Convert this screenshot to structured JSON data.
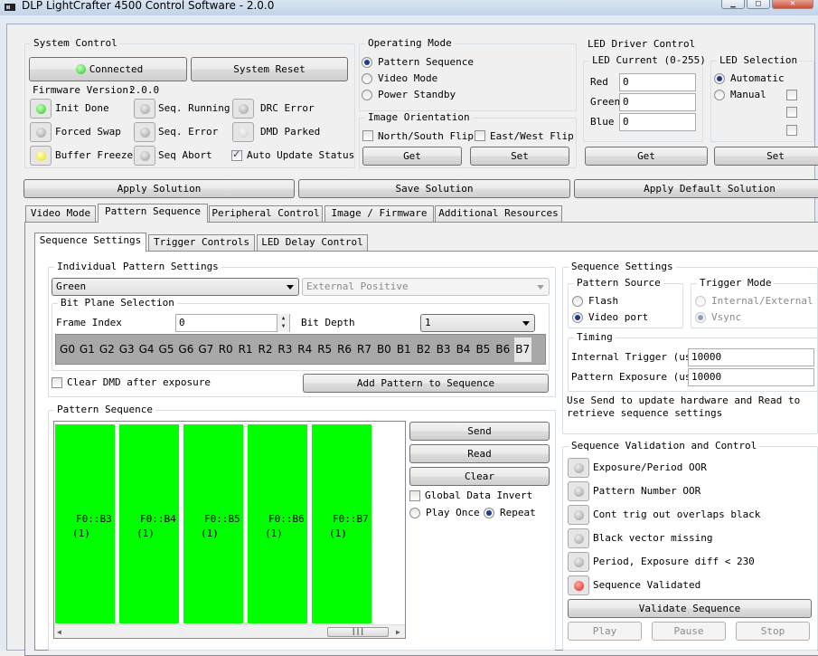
{
  "window": {
    "title": "DLP LightCrafter 4500 Control Software - 2.0.0"
  },
  "system_control": {
    "title": "System Control",
    "connect_label": "Connected",
    "reset_label": "System Reset",
    "firmware_label": "Firmware Version:",
    "firmware_value": "2.0.0",
    "status": [
      {
        "label": "Init Done",
        "state": "green"
      },
      {
        "label": "Seq. Running",
        "state": "gray"
      },
      {
        "label": "DRC Error",
        "state": "gray"
      },
      {
        "label": "Forced Swap",
        "state": "gray"
      },
      {
        "label": "Seq. Error",
        "state": "gray"
      },
      {
        "label": "DMD Parked",
        "state": "light"
      },
      {
        "label": "Buffer Freeze",
        "state": "yellow"
      },
      {
        "label": "Seq Abort",
        "state": "gray"
      }
    ],
    "auto_update_label": "Auto Update Status",
    "auto_update_checked": true
  },
  "operating_mode": {
    "title": "Operating Mode",
    "options": [
      "Pattern Sequence",
      "Video Mode",
      "Power Standby"
    ],
    "selected": "Pattern Sequence"
  },
  "image_orientation": {
    "title": "Image Orientation",
    "ns_flip": "North/South Flip",
    "ew_flip": "East/West Flip",
    "get_label": "Get",
    "set_label": "Set"
  },
  "led_driver": {
    "title": "LED Driver Control",
    "current_title": "LED Current (0-255)",
    "red_label": "Red",
    "red_value": "0",
    "green_label": "Green",
    "green_value": "0",
    "blue_label": "Blue",
    "blue_value": "0",
    "selection_title": "LED Selection",
    "automatic_label": "Automatic",
    "manual_label": "Manual",
    "selected": "Automatic",
    "get_label": "Get",
    "set_label": "Set"
  },
  "solutions": {
    "apply_label": "Apply Solution",
    "save_label": "Save Solution",
    "default_label": "Apply Default Solution"
  },
  "main_tabs": [
    "Video Mode",
    "Pattern Sequence",
    "Peripheral Control",
    "Image / Firmware",
    "Additional Resources"
  ],
  "main_tab_active": "Pattern Sequence",
  "sub_tabs": [
    "Sequence Settings",
    "Trigger Controls",
    "LED Delay Control"
  ],
  "sub_tab_active": "Sequence Settings",
  "individual_pattern": {
    "title": "Individual Pattern Settings",
    "color_value": "Green",
    "trigger_value": "External Positive",
    "bitplane_title": "Bit Plane Selection",
    "frame_index_label": "Frame Index",
    "frame_index_value": "0",
    "bit_depth_label": "Bit Depth",
    "bit_depth_value": "1",
    "bits": [
      "G0",
      "G1",
      "G2",
      "G3",
      "G4",
      "G5",
      "G6",
      "G7",
      "R0",
      "R1",
      "R2",
      "R3",
      "R4",
      "R5",
      "R6",
      "R7",
      "B0",
      "B1",
      "B2",
      "B3",
      "B4",
      "B5",
      "B6",
      "B7"
    ],
    "clear_dmd_label": "Clear DMD after exposure",
    "add_pattern_label": "Add Pattern to Sequence"
  },
  "pattern_sequence": {
    "title": "Pattern Sequence",
    "slots": [
      {
        "label": "F0::B3",
        "sub": "(1)"
      },
      {
        "label": "F0::B4",
        "sub": "(1)"
      },
      {
        "label": "F0::B5",
        "sub": "(1)"
      },
      {
        "label": "F0::B6",
        "sub": "(1)"
      },
      {
        "label": "F0::B7",
        "sub": "(1)"
      }
    ],
    "slot_color": "#00ff00",
    "send_label": "Send",
    "read_label": "Read",
    "clear_label": "Clear",
    "global_invert_label": "Global Data Invert",
    "play_once_label": "Play Once",
    "repeat_label": "Repeat",
    "selected_mode": "Repeat"
  },
  "sequence_settings": {
    "title": "Sequence Settings",
    "pattern_source_title": "Pattern Source",
    "flash_label": "Flash",
    "video_port_label": "Video port",
    "source_selected": "Video port",
    "trigger_mode_title": "Trigger Mode",
    "internal_external_label": "Internal/External",
    "vsync_label": "Vsync",
    "timing_title": "Timing",
    "internal_trigger_label": "Internal Trigger (us)",
    "internal_trigger_value": "10000",
    "pattern_exposure_label": "Pattern Exposure (us)",
    "pattern_exposure_value": "10000",
    "note_line1": "Use Send to update hardware and Read to",
    "note_line2": "retrieve sequence settings"
  },
  "validation": {
    "title": "Sequence Validation and Control",
    "items": [
      {
        "label": "Exposure/Period OOR",
        "state": "gray"
      },
      {
        "label": "Pattern Number OOR",
        "state": "gray"
      },
      {
        "label": "Cont trig out overlaps black",
        "state": "gray"
      },
      {
        "label": "Black vector missing",
        "state": "gray"
      },
      {
        "label": "Period, Exposure diff < 230",
        "state": "gray"
      },
      {
        "label": "Sequence Validated",
        "state": "red"
      }
    ],
    "validate_label": "Validate Sequence",
    "play_label": "Play",
    "pause_label": "Pause",
    "stop_label": "Stop"
  },
  "colors": {
    "accent_green": "#00ff00",
    "led_red": "#e81a1a",
    "led_yellow": "#e8dc00",
    "led_green": "#22c822"
  }
}
